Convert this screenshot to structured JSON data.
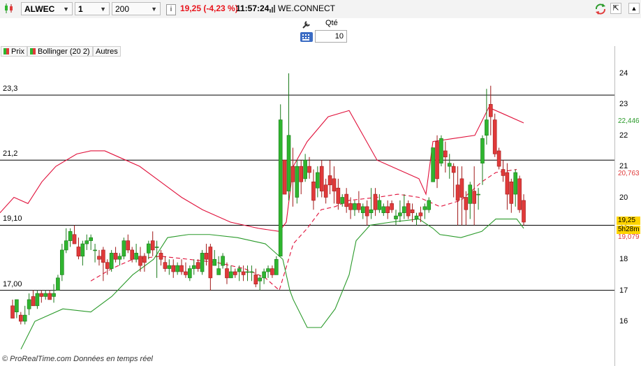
{
  "toolbar": {
    "symbol": "ALWEC",
    "period": "1 jour",
    "units": "200 unités",
    "info_icon_text": "i",
    "price_change": "19,25 (-4,23 %)",
    "time": "11:57:24",
    "exchange": "WE.CONNECT",
    "colors": {
      "negative": "#e8141c",
      "bg": "#f3f3f3"
    }
  },
  "order": {
    "qty_label": "Qté",
    "qty_value": "10"
  },
  "legend": [
    {
      "label": "Prix",
      "color_a": "#2fb52f",
      "color_b": "#e03a3a"
    },
    {
      "label": "Bollinger (20 2)",
      "color_a": "#2fb52f",
      "color_b": "#e03a3a"
    },
    {
      "label": "Autres"
    }
  ],
  "levels": [
    {
      "label": "23,3",
      "value": 23.3
    },
    {
      "label": "21,2",
      "value": 21.2
    },
    {
      "label": "19,10",
      "value": 19.1
    },
    {
      "label": "17,00",
      "value": 17.0
    }
  ],
  "axis": {
    "ticks": [
      "24",
      "23",
      "22",
      "21",
      "20",
      "19",
      "18",
      "17",
      "16"
    ]
  },
  "price_tags": [
    {
      "label": "22,446",
      "value": 22.446,
      "color": "#2a9a2a"
    },
    {
      "label": "20,763",
      "value": 20.763,
      "color": "#e03a3a"
    },
    {
      "label": "19,25",
      "value": 19.25,
      "color": "#000000",
      "bg": "#ffd400"
    },
    {
      "label": "5h28m",
      "value": 18.95,
      "color": "#000000",
      "bg": "#ffd400"
    },
    {
      "label": "19,079",
      "value": 18.7,
      "color": "#e03a3a"
    }
  ],
  "footer": "© ProRealTime.com  Données en temps réel",
  "chart_data": {
    "type": "candlestick",
    "y_axis_range": [
      15.0,
      24.3
    ],
    "candles": [
      [
        16.5,
        16.7,
        16.1,
        16.1
      ],
      [
        16.3,
        16.7,
        16.1,
        16.7
      ],
      [
        16.2,
        16.3,
        15.9,
        16.0
      ],
      [
        16.0,
        16.5,
        15.9,
        16.2
      ],
      [
        16.4,
        16.9,
        16.2,
        16.7
      ],
      [
        16.8,
        17.0,
        16.5,
        16.5
      ],
      [
        16.5,
        17.0,
        16.4,
        16.9
      ],
      [
        16.9,
        17.0,
        16.6,
        16.8
      ],
      [
        16.8,
        17.0,
        16.7,
        16.9
      ],
      [
        16.9,
        17.0,
        16.7,
        16.7
      ],
      [
        16.8,
        17.2,
        16.6,
        16.9
      ],
      [
        17.0,
        17.5,
        17.0,
        17.4
      ],
      [
        17.5,
        18.5,
        17.3,
        18.3
      ],
      [
        18.3,
        19.0,
        18.2,
        18.6
      ],
      [
        18.6,
        19.0,
        18.4,
        18.9
      ],
      [
        18.8,
        19.1,
        18.5,
        18.5
      ],
      [
        18.4,
        18.7,
        18.0,
        18.1
      ],
      [
        18.1,
        18.6,
        17.8,
        18.5
      ],
      [
        18.5,
        18.8,
        18.3,
        18.6
      ],
      [
        18.6,
        18.8,
        18.3,
        18.7
      ],
      [
        18.3,
        18.5,
        17.9,
        18.3
      ],
      [
        18.1,
        18.3,
        17.8,
        18.0
      ],
      [
        18.3,
        18.4,
        17.3,
        17.9
      ],
      [
        17.9,
        18.0,
        17.5,
        17.7
      ],
      [
        17.7,
        18.3,
        17.6,
        18.2
      ],
      [
        18.2,
        18.4,
        17.9,
        18.0
      ],
      [
        18.0,
        18.2,
        17.8,
        18.1
      ],
      [
        18.1,
        18.7,
        18.0,
        18.6
      ],
      [
        18.6,
        18.8,
        18.2,
        18.3
      ],
      [
        18.3,
        18.4,
        17.9,
        18.0
      ],
      [
        18.0,
        18.5,
        17.9,
        18.2
      ],
      [
        18.1,
        18.4,
        17.6,
        17.8
      ],
      [
        18.1,
        18.2,
        17.6,
        17.9
      ],
      [
        18.2,
        18.6,
        18.0,
        18.5
      ],
      [
        18.6,
        18.9,
        18.1,
        18.3
      ],
      [
        18.4,
        18.6,
        17.4,
        18.4
      ],
      [
        18.2,
        18.3,
        17.8,
        18.0
      ],
      [
        17.9,
        18.1,
        17.6,
        17.7
      ],
      [
        17.7,
        18.0,
        17.5,
        17.8
      ],
      [
        17.8,
        18.0,
        17.4,
        17.6
      ],
      [
        17.6,
        17.9,
        17.5,
        17.8
      ],
      [
        17.8,
        18.0,
        17.5,
        17.6
      ],
      [
        17.6,
        17.9,
        17.4,
        17.5
      ],
      [
        17.4,
        17.8,
        17.3,
        17.7
      ],
      [
        17.7,
        18.0,
        17.5,
        17.8
      ],
      [
        17.9,
        18.0,
        17.6,
        17.7
      ],
      [
        17.6,
        18.3,
        17.5,
        18.2
      ],
      [
        18.2,
        18.5,
        17.8,
        18.0
      ],
      [
        18.4,
        18.5,
        17.0,
        17.4
      ],
      [
        17.8,
        18.3,
        17.8,
        18.0
      ],
      [
        17.5,
        18.1,
        17.5,
        17.7
      ],
      [
        17.8,
        18.2,
        17.7,
        18.1
      ],
      [
        17.7,
        17.9,
        17.2,
        17.4
      ],
      [
        17.4,
        17.8,
        17.4,
        17.6
      ],
      [
        17.6,
        17.7,
        17.4,
        17.5
      ],
      [
        17.6,
        17.8,
        17.3,
        17.7
      ],
      [
        17.6,
        17.8,
        17.3,
        17.5
      ],
      [
        17.6,
        17.8,
        17.3,
        17.6
      ],
      [
        17.6,
        17.8,
        17.3,
        17.6
      ],
      [
        17.5,
        17.7,
        17.1,
        17.2
      ],
      [
        17.3,
        17.5,
        17.0,
        17.4
      ],
      [
        17.4,
        17.7,
        17.2,
        17.6
      ],
      [
        17.6,
        17.8,
        17.4,
        17.7
      ],
      [
        17.7,
        17.8,
        17.4,
        17.5
      ],
      [
        17.5,
        18.1,
        17.5,
        18.0
      ],
      [
        18.1,
        23.0,
        19.2,
        22.5
      ],
      [
        21.2,
        21.2,
        20.1,
        20.1
      ],
      [
        20.2,
        24.0,
        19.9,
        22.0
      ],
      [
        21.0,
        21.6,
        19.7,
        20.5
      ],
      [
        20.0,
        21.2,
        19.8,
        21.0
      ],
      [
        21.0,
        21.2,
        20.1,
        20.5
      ],
      [
        20.6,
        21.4,
        20.5,
        21.2
      ],
      [
        21.0,
        21.3,
        20.6,
        20.8
      ],
      [
        20.5,
        20.9,
        19.6,
        19.9
      ],
      [
        20.3,
        21.0,
        20.0,
        20.8
      ],
      [
        21.0,
        21.2,
        20.0,
        20.2
      ],
      [
        20.4,
        20.6,
        19.8,
        20.0
      ],
      [
        20.7,
        21.2,
        20.1,
        20.4
      ],
      [
        20.6,
        21.0,
        19.8,
        20.2
      ],
      [
        20.3,
        20.6,
        19.6,
        19.8
      ],
      [
        19.8,
        20.1,
        19.7,
        20.0
      ],
      [
        20.1,
        20.3,
        19.5,
        19.7
      ],
      [
        19.8,
        20.0,
        19.3,
        19.6
      ],
      [
        19.6,
        19.9,
        19.4,
        19.8
      ],
      [
        19.8,
        20.2,
        19.5,
        19.6
      ],
      [
        19.5,
        19.8,
        19.3,
        19.7
      ],
      [
        19.7,
        19.9,
        19.1,
        19.4
      ],
      [
        19.5,
        20.3,
        19.3,
        19.6
      ],
      [
        20.1,
        20.3,
        19.4,
        19.6
      ],
      [
        19.6,
        20.1,
        19.5,
        19.9
      ],
      [
        19.5,
        19.8,
        19.4,
        19.7
      ],
      [
        19.7,
        19.9,
        19.3,
        19.5
      ],
      [
        19.8,
        19.9,
        19.5,
        19.6
      ],
      [
        19.3,
        19.6,
        19.1,
        19.4
      ],
      [
        19.4,
        19.9,
        19.2,
        19.5
      ],
      [
        19.5,
        20.1,
        19.3,
        19.7
      ],
      [
        19.8,
        19.9,
        19.3,
        19.4
      ],
      [
        19.6,
        19.8,
        19.2,
        19.5
      ],
      [
        19.3,
        19.5,
        19.1,
        19.4
      ],
      [
        19.5,
        19.7,
        19.2,
        19.4
      ],
      [
        19.6,
        19.8,
        19.3,
        19.7
      ],
      [
        19.6,
        20.0,
        19.5,
        19.9
      ],
      [
        20.5,
        21.6,
        20.5,
        21.6
      ],
      [
        21.8,
        22.0,
        20.3,
        20.6
      ],
      [
        21.1,
        22.0,
        21.0,
        21.9
      ],
      [
        21.5,
        21.8,
        20.8,
        21.3
      ],
      [
        21.0,
        21.4,
        20.6,
        21.1
      ],
      [
        21.0,
        21.1,
        20.0,
        20.8
      ],
      [
        20.4,
        21.0,
        19.1,
        19.9
      ],
      [
        20.6,
        21.0,
        19.1,
        20.0
      ],
      [
        20.0,
        20.2,
        19.1,
        19.6
      ],
      [
        19.8,
        20.5,
        19.3,
        20.4
      ],
      [
        20.2,
        21.0,
        19.1,
        19.8
      ],
      [
        20.1,
        20.3,
        19.6,
        20.1
      ],
      [
        21.1,
        22.0,
        20.4,
        21.9
      ],
      [
        22.0,
        23.5,
        21.7,
        22.5
      ],
      [
        23.0,
        23.6,
        22.0,
        22.6
      ],
      [
        22.5,
        22.7,
        21.3,
        21.4
      ],
      [
        21.5,
        21.6,
        20.9,
        21.0
      ],
      [
        20.9,
        21.2,
        20.5,
        20.7
      ],
      [
        20.8,
        21.1,
        19.6,
        20.1
      ],
      [
        20.5,
        20.6,
        19.5,
        19.8
      ],
      [
        20.1,
        20.9,
        19.7,
        20.8
      ],
      [
        20.6,
        20.7,
        19.5,
        19.6
      ],
      [
        19.9,
        20.1,
        19.1,
        19.2
      ]
    ],
    "bollinger_upper": [
      [
        0,
        19.5
      ],
      [
        20,
        20.0
      ],
      [
        40,
        19.8
      ],
      [
        60,
        20.5
      ],
      [
        80,
        21.0
      ],
      [
        110,
        21.4
      ],
      [
        130,
        21.5
      ],
      [
        150,
        21.5
      ],
      [
        170,
        21.3
      ],
      [
        200,
        21.0
      ],
      [
        230,
        20.5
      ],
      [
        260,
        20.0
      ],
      [
        290,
        19.6
      ],
      [
        330,
        19.2
      ],
      [
        370,
        19.0
      ],
      [
        400,
        18.9
      ],
      [
        410,
        19.2
      ],
      [
        420,
        21.0
      ],
      [
        440,
        21.8
      ],
      [
        470,
        22.6
      ],
      [
        500,
        22.8
      ],
      [
        520,
        22.0
      ],
      [
        540,
        21.2
      ],
      [
        560,
        21.0
      ],
      [
        600,
        20.6
      ],
      [
        610,
        20.1
      ],
      [
        620,
        21.8
      ],
      [
        650,
        21.9
      ],
      [
        680,
        22.0
      ],
      [
        700,
        22.9
      ],
      [
        720,
        22.7
      ],
      [
        750,
        22.4
      ]
    ],
    "bollinger_middle": [
      [
        130,
        17.3
      ],
      [
        160,
        17.7
      ],
      [
        190,
        18.0
      ],
      [
        230,
        18.1
      ],
      [
        270,
        18.0
      ],
      [
        310,
        17.9
      ],
      [
        350,
        17.7
      ],
      [
        380,
        17.4
      ],
      [
        400,
        17.0
      ],
      [
        420,
        18.5
      ],
      [
        440,
        19.0
      ],
      [
        460,
        19.6
      ],
      [
        480,
        19.7
      ],
      [
        500,
        19.9
      ],
      [
        540,
        20.0
      ],
      [
        570,
        20.1
      ],
      [
        600,
        20.0
      ],
      [
        630,
        19.7
      ],
      [
        660,
        19.9
      ],
      [
        690,
        20.5
      ],
      [
        710,
        20.8
      ],
      [
        740,
        20.9
      ]
    ],
    "bollinger_lower": [
      [
        30,
        15.1
      ],
      [
        50,
        16.0
      ],
      [
        90,
        16.4
      ],
      [
        130,
        16.3
      ],
      [
        160,
        16.8
      ],
      [
        190,
        17.5
      ],
      [
        220,
        18.0
      ],
      [
        240,
        18.7
      ],
      [
        270,
        18.8
      ],
      [
        300,
        18.8
      ],
      [
        340,
        18.7
      ],
      [
        380,
        18.5
      ],
      [
        405,
        18.0
      ],
      [
        415,
        17.0
      ],
      [
        420,
        16.7
      ],
      [
        440,
        15.8
      ],
      [
        460,
        15.8
      ],
      [
        480,
        16.4
      ],
      [
        500,
        17.5
      ],
      [
        510,
        18.6
      ],
      [
        530,
        19.1
      ],
      [
        560,
        19.2
      ],
      [
        600,
        19.3
      ],
      [
        620,
        19.0
      ],
      [
        630,
        18.8
      ],
      [
        660,
        18.7
      ],
      [
        690,
        18.9
      ],
      [
        710,
        19.3
      ],
      [
        740,
        19.3
      ],
      [
        750,
        19.0
      ]
    ]
  }
}
